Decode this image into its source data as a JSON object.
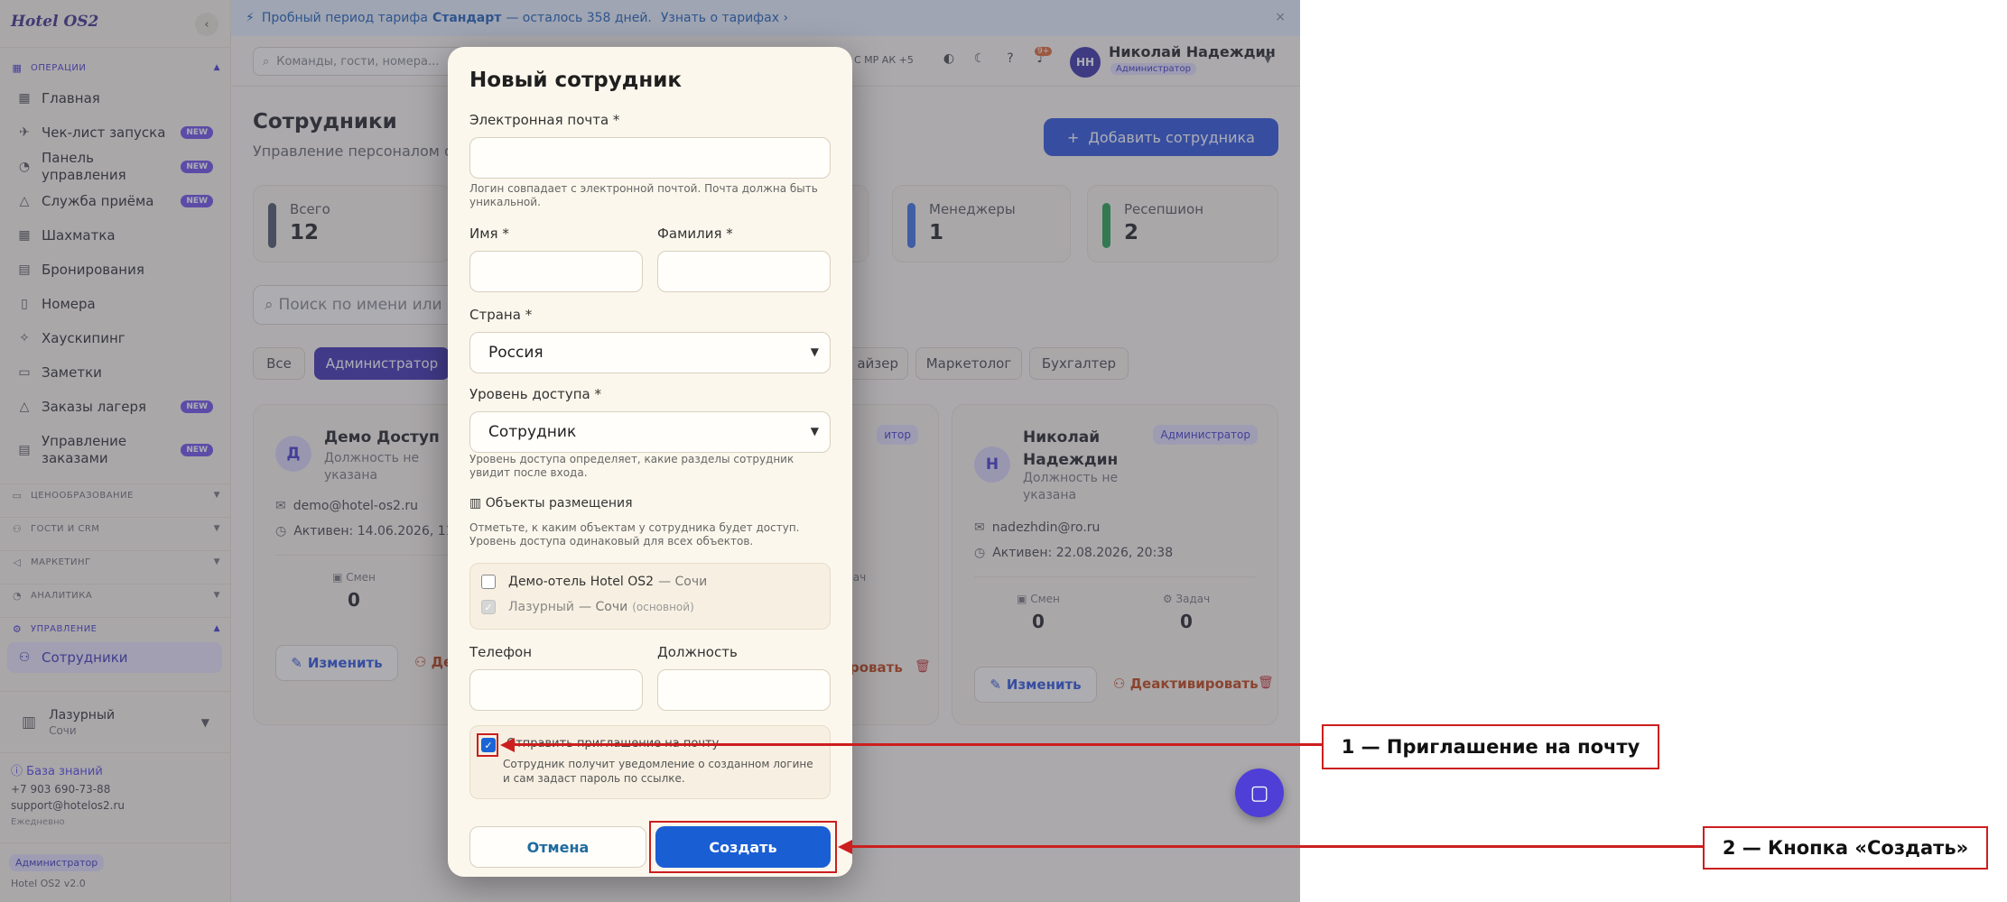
{
  "sidebar": {
    "brand": "Hotel OS2",
    "collapse_glyph": "‹",
    "sections": [
      {
        "label": "ОПЕРАЦИИ",
        "icon": "grid-icon",
        "glyph": "▦",
        "expanded": true
      },
      {
        "label": "ЦЕНООБРАЗОВАНИЕ",
        "icon": "tag-icon",
        "glyph": "▭",
        "expanded": false
      },
      {
        "label": "ГОСТИ И CRM",
        "icon": "users-icon",
        "glyph": "⚇",
        "expanded": false
      },
      {
        "label": "МАРКЕТИНГ",
        "icon": "megaphone-icon",
        "glyph": "◁",
        "expanded": false
      },
      {
        "label": "АНАЛИТИКА",
        "icon": "gauge-icon",
        "glyph": "◔",
        "expanded": false
      },
      {
        "label": "УПРАВЛЕНИЕ",
        "icon": "gear-icon",
        "glyph": "⚙",
        "expanded": true
      }
    ],
    "items": [
      {
        "label": "Главная",
        "icon": "dashboard-icon",
        "glyph": "▦",
        "badge": ""
      },
      {
        "label": "Чек-лист запуска",
        "icon": "rocket-icon",
        "glyph": "✈",
        "badge": "NEW"
      },
      {
        "label": "Панель управления",
        "icon": "gauge-icon",
        "glyph": "◔",
        "badge": "NEW"
      },
      {
        "label": "Служба приёма",
        "icon": "bell-icon",
        "glyph": "△",
        "badge": "NEW"
      },
      {
        "label": "Шахматка",
        "icon": "grid-icon",
        "glyph": "▦",
        "badge": ""
      },
      {
        "label": "Бронирования",
        "icon": "clipboard-icon",
        "glyph": "▤",
        "badge": ""
      },
      {
        "label": "Номера",
        "icon": "door-icon",
        "glyph": "▯",
        "badge": ""
      },
      {
        "label": "Хаускипинг",
        "icon": "sparkle-icon",
        "glyph": "✧",
        "badge": ""
      },
      {
        "label": "Заметки",
        "icon": "note-icon",
        "glyph": "▭",
        "badge": ""
      },
      {
        "label": "Заказы лагеря",
        "icon": "tent-icon",
        "glyph": "△",
        "badge": "NEW"
      },
      {
        "label": "Управление заказами",
        "icon": "orders-icon",
        "glyph": "▤",
        "badge": "NEW"
      },
      {
        "label": "Сотрудники",
        "icon": "user-icon",
        "glyph": "⚇",
        "badge": ""
      }
    ],
    "property": {
      "name": "Лазурный",
      "city": "Сочи",
      "icon": "building-icon",
      "glyph": "▥"
    },
    "knowledge_base": "База знаний",
    "phone": "+7 903 690-73-88",
    "email": "support@hotelos2.ru",
    "hours": "Ежедневно",
    "role_badge": "Администратор",
    "version": "Hotel OS2 v2.0"
  },
  "trial_banner": {
    "prefix": "Пробный период тарифа",
    "plan": "Стандарт",
    "suffix": "— осталось 358 дней.",
    "link": "Узнать о тарифах ›",
    "close": "×"
  },
  "topbar": {
    "command_placeholder": "Команды, гости, номера...",
    "presence": "С МР АК +5",
    "bell_count": "9+",
    "user_initials": "НН",
    "user_name": "Николай Надеждин",
    "user_role": "Администратор"
  },
  "page": {
    "title": "Сотрудники",
    "subtitle": "Управление персоналом от",
    "add_button": "Добавить сотрудника",
    "stats": [
      {
        "label": "Всего",
        "value": "12",
        "color": "#4b5563"
      },
      {
        "label": "Менеджеры",
        "value": "1",
        "color": "#3b6fe0"
      },
      {
        "label": "Ресепшион",
        "value": "2",
        "color": "#22a04a"
      }
    ],
    "search_placeholder": "Поиск по имени или ema",
    "filters": [
      "Все",
      "Администратор",
      "айзер",
      "Маркетолог",
      "Бухгалтер"
    ],
    "cards": [
      {
        "initial": "Д",
        "name": "Демо Доступ",
        "position": "Должность не указана",
        "role": "",
        "email": "demo@hotel-os2.ru",
        "active": "Активен: 14.06.2026, 11:13",
        "shifts_label": "Смен",
        "shifts": "0",
        "tasks_label": "",
        "tasks": "",
        "edit": "Изменить",
        "deactivate": "Де"
      },
      {
        "initial": "",
        "name": "",
        "position": "",
        "role": "итор",
        "email": "",
        "active": "",
        "shifts_label": "",
        "shifts": "",
        "tasks_label": "ач",
        "tasks": "",
        "edit": "",
        "deactivate": "ровать"
      },
      {
        "initial": "Н",
        "name": "Николай Надеждин",
        "position": "Должность не указана",
        "role": "Администратор",
        "email": "nadezhdin@ro.ru",
        "active": "Активен: 22.08.2026, 20:38",
        "shifts_label": "Смен",
        "shifts": "0",
        "tasks_label": "Задач",
        "tasks": "0",
        "edit": "Изменить",
        "deactivate": "Деактивировать"
      }
    ]
  },
  "modal": {
    "title": "Новый сотрудник",
    "email_label": "Электронная почта *",
    "email_help": "Логин совпадает с электронной почтой. Почта должна быть уникальной.",
    "first_name_label": "Имя *",
    "last_name_label": "Фамилия *",
    "country_label": "Страна *",
    "country_value": "Россия",
    "access_label": "Уровень доступа *",
    "access_value": "Сотрудник",
    "access_help": "Уровень доступа определяет, какие разделы сотрудник увидит после входа.",
    "objects_title": "Объекты размещения",
    "objects_help": "Отметьте, к каким объектам у сотрудника будет доступ. Уровень доступа одинаковый для всех объектов.",
    "objects": [
      {
        "name": "Демо-отель Hotel OS2",
        "city": "— Сочи",
        "tag": "",
        "checked": false,
        "disabled": false
      },
      {
        "name": "Лазурный",
        "city": "— Сочи",
        "tag": "(основной)",
        "checked": true,
        "disabled": true
      }
    ],
    "phone_label": "Телефон",
    "position_label": "Должность",
    "invite_label": "Отправить приглашение на почту",
    "invite_help": "Сотрудник получит уведомление о созданном логине и сам задаст пароль по ссылке.",
    "cancel": "Отмена",
    "create": "Создать"
  },
  "annotations": [
    {
      "label": "1 — Приглашение на почту"
    },
    {
      "label": "2 — Кнопка «Создать»"
    }
  ],
  "colors": {
    "accent": "#2b52d9",
    "annotation": "#cc1e1e",
    "new_badge": "#6d4fe6"
  }
}
